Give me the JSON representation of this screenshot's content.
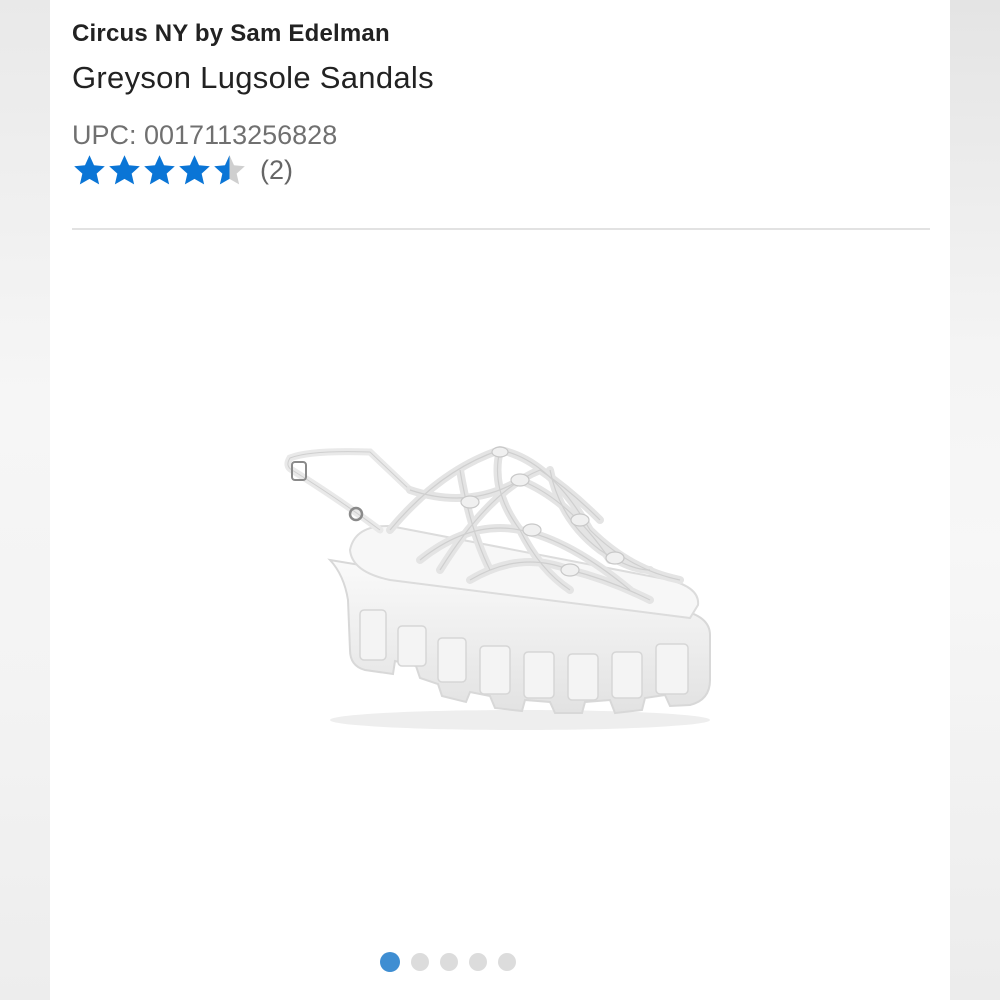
{
  "product": {
    "brand": "Circus NY by Sam Edelman",
    "name": "Greyson Lugsole Sandals",
    "upc": "UPC: 0017113256828",
    "rating": {
      "value": 4.5,
      "max": 5,
      "count_label": "(2)",
      "star_color": "#0a75d6",
      "empty_star_color": "#cfcfcf"
    },
    "image": {
      "alt": "Greyson Lugsole Sandals",
      "color": "white"
    }
  },
  "carousel": {
    "total": 5,
    "active_index": 0,
    "active_color": "#3f8ed2",
    "inactive_color": "#dcdcdc"
  }
}
